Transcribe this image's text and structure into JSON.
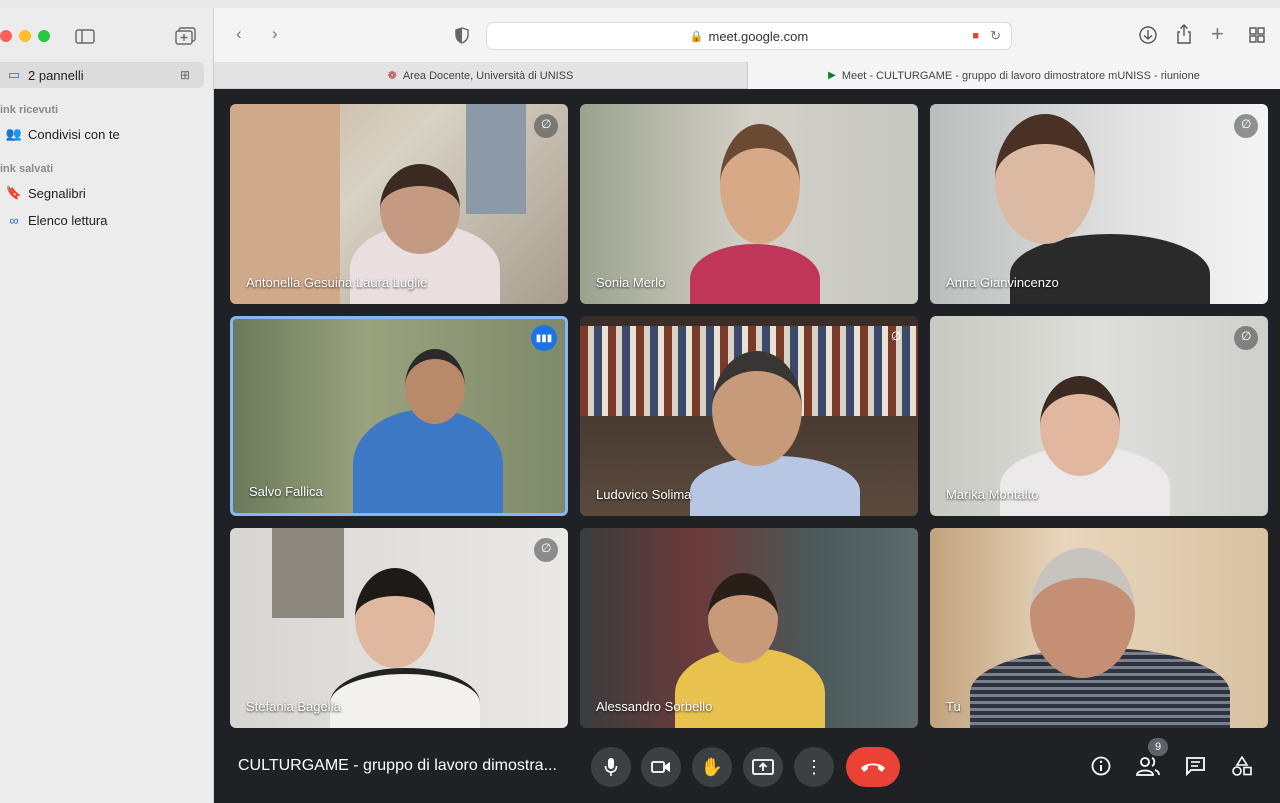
{
  "browser": {
    "sidebar": {
      "panels_label": "2 pannelli",
      "section_received": "ink ricevuti",
      "shared_with_you": "Condivisi con te",
      "section_saved": "ink salvati",
      "bookmarks": "Segnalibri",
      "reading_list": "Elenco lettura"
    },
    "url": "meet.google.com",
    "tabs": [
      {
        "label": "Area Docente, Università di UNISS"
      },
      {
        "label": "Meet - CULTURGAME - gruppo di lavoro dimostratore mUNISS - riunione"
      }
    ]
  },
  "meet": {
    "participants": [
      {
        "name": "Antonella Gesuina Laura Luglie",
        "muted": true
      },
      {
        "name": "Sonia Merlo",
        "muted": false
      },
      {
        "name": "Anna Gianvincenzo",
        "muted": true
      },
      {
        "name": "Salvo Fallica",
        "speaking": true
      },
      {
        "name": "Ludovico Solima",
        "muted": true
      },
      {
        "name": "Marika Montalto",
        "muted": true
      },
      {
        "name": "Stefania Bagella",
        "muted": true
      },
      {
        "name": "Alessandro Sorbello",
        "muted": false
      },
      {
        "name": "Tu",
        "muted": false
      }
    ],
    "meeting_title": "CULTURGAME - gruppo di lavoro dimostra...",
    "participant_count": "9",
    "colors": {
      "end_call": "#ea4335",
      "active_speaker": "#8ab4f8",
      "background": "#202124"
    }
  }
}
